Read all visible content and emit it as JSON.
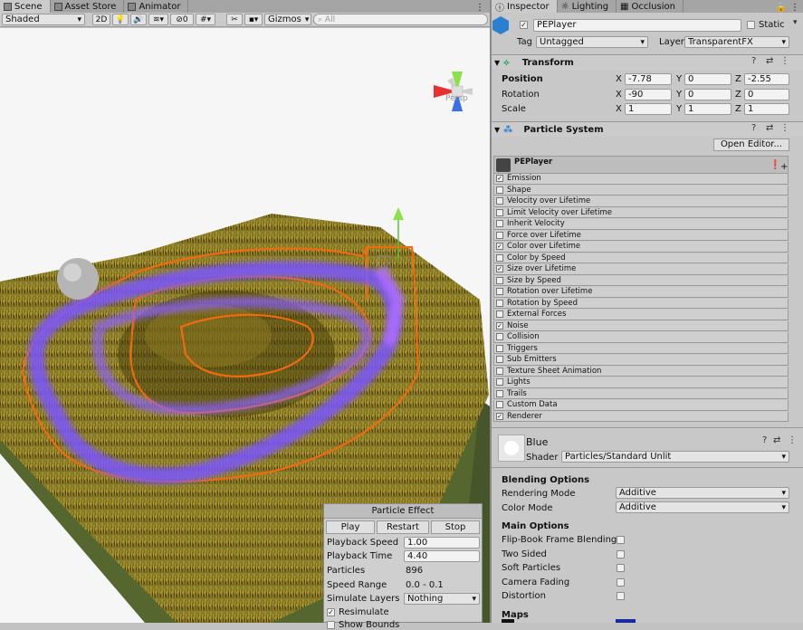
{
  "tabs_left": [
    "Scene",
    "Asset Store",
    "Animator"
  ],
  "tabs_right": [
    "Inspector",
    "Lighting",
    "Occlusion"
  ],
  "scene_toolbar": {
    "shading": "Shaded",
    "mode_2d": "2D",
    "hidden_count": "0",
    "gizmos": "Gizmos",
    "search_placeholder": "All",
    "persp": "Persp"
  },
  "object": {
    "name": "PEPlayer",
    "static_label": "Static",
    "tag_label": "Tag",
    "tag": "Untagged",
    "layer_label": "Layer",
    "layer": "TransparentFX"
  },
  "transform": {
    "title": "Transform",
    "position_label": "Position",
    "rotation_label": "Rotation",
    "scale_label": "Scale",
    "position": [
      "-7.78",
      "0",
      "-2.55"
    ],
    "rotation": [
      "-90",
      "0",
      "0"
    ],
    "scale": [
      "1",
      "1",
      "1"
    ],
    "axes": [
      "X",
      "Y",
      "Z"
    ]
  },
  "particle_system": {
    "title": "Particle System",
    "open_editor": "Open Editor...",
    "system_name": "PEPlayer",
    "modules": [
      {
        "label": "Emission",
        "checked": true
      },
      {
        "label": "Shape",
        "checked": false
      },
      {
        "label": "Velocity over Lifetime",
        "checked": false
      },
      {
        "label": "Limit Velocity over Lifetime",
        "checked": false
      },
      {
        "label": "Inherit Velocity",
        "checked": false
      },
      {
        "label": "Force over Lifetime",
        "checked": false
      },
      {
        "label": "Color over Lifetime",
        "checked": true
      },
      {
        "label": "Color by Speed",
        "checked": false
      },
      {
        "label": "Size over Lifetime",
        "checked": true
      },
      {
        "label": "Size by Speed",
        "checked": false
      },
      {
        "label": "Rotation over Lifetime",
        "checked": false
      },
      {
        "label": "Rotation by Speed",
        "checked": false
      },
      {
        "label": "External Forces",
        "checked": false
      },
      {
        "label": "Noise",
        "checked": true
      },
      {
        "label": "Collision",
        "checked": false
      },
      {
        "label": "Triggers",
        "checked": false
      },
      {
        "label": "Sub Emitters",
        "checked": false
      },
      {
        "label": "Texture Sheet Animation",
        "checked": false
      },
      {
        "label": "Lights",
        "checked": false
      },
      {
        "label": "Trails",
        "checked": false
      },
      {
        "label": "Custom Data",
        "checked": false
      },
      {
        "label": "Renderer",
        "checked": true
      }
    ]
  },
  "material": {
    "name": "Blue",
    "shader_label": "Shader",
    "shader": "Particles/Standard Unlit",
    "blending_title": "Blending Options",
    "rendering_mode_label": "Rendering Mode",
    "rendering_mode": "Additive",
    "color_mode_label": "Color Mode",
    "color_mode": "Additive",
    "main_title": "Main Options",
    "options": [
      "Flip-Book Frame Blending",
      "Two Sided",
      "Soft Particles",
      "Camera Fading",
      "Distortion"
    ],
    "maps_title": "Maps"
  },
  "particle_effect": {
    "title": "Particle Effect",
    "play": "Play",
    "restart": "Restart",
    "stop": "Stop",
    "playback_speed_label": "Playback Speed",
    "playback_speed": "1.00",
    "playback_time_label": "Playback Time",
    "playback_time": "4.40",
    "particles_label": "Particles",
    "particles": "896",
    "speed_range_label": "Speed Range",
    "speed_range": "0.0 - 0.1",
    "simulate_layers_label": "Simulate Layers",
    "simulate_layers": "Nothing",
    "resimulate_label": "Resimulate",
    "show_bounds_label": "Show Bounds"
  }
}
